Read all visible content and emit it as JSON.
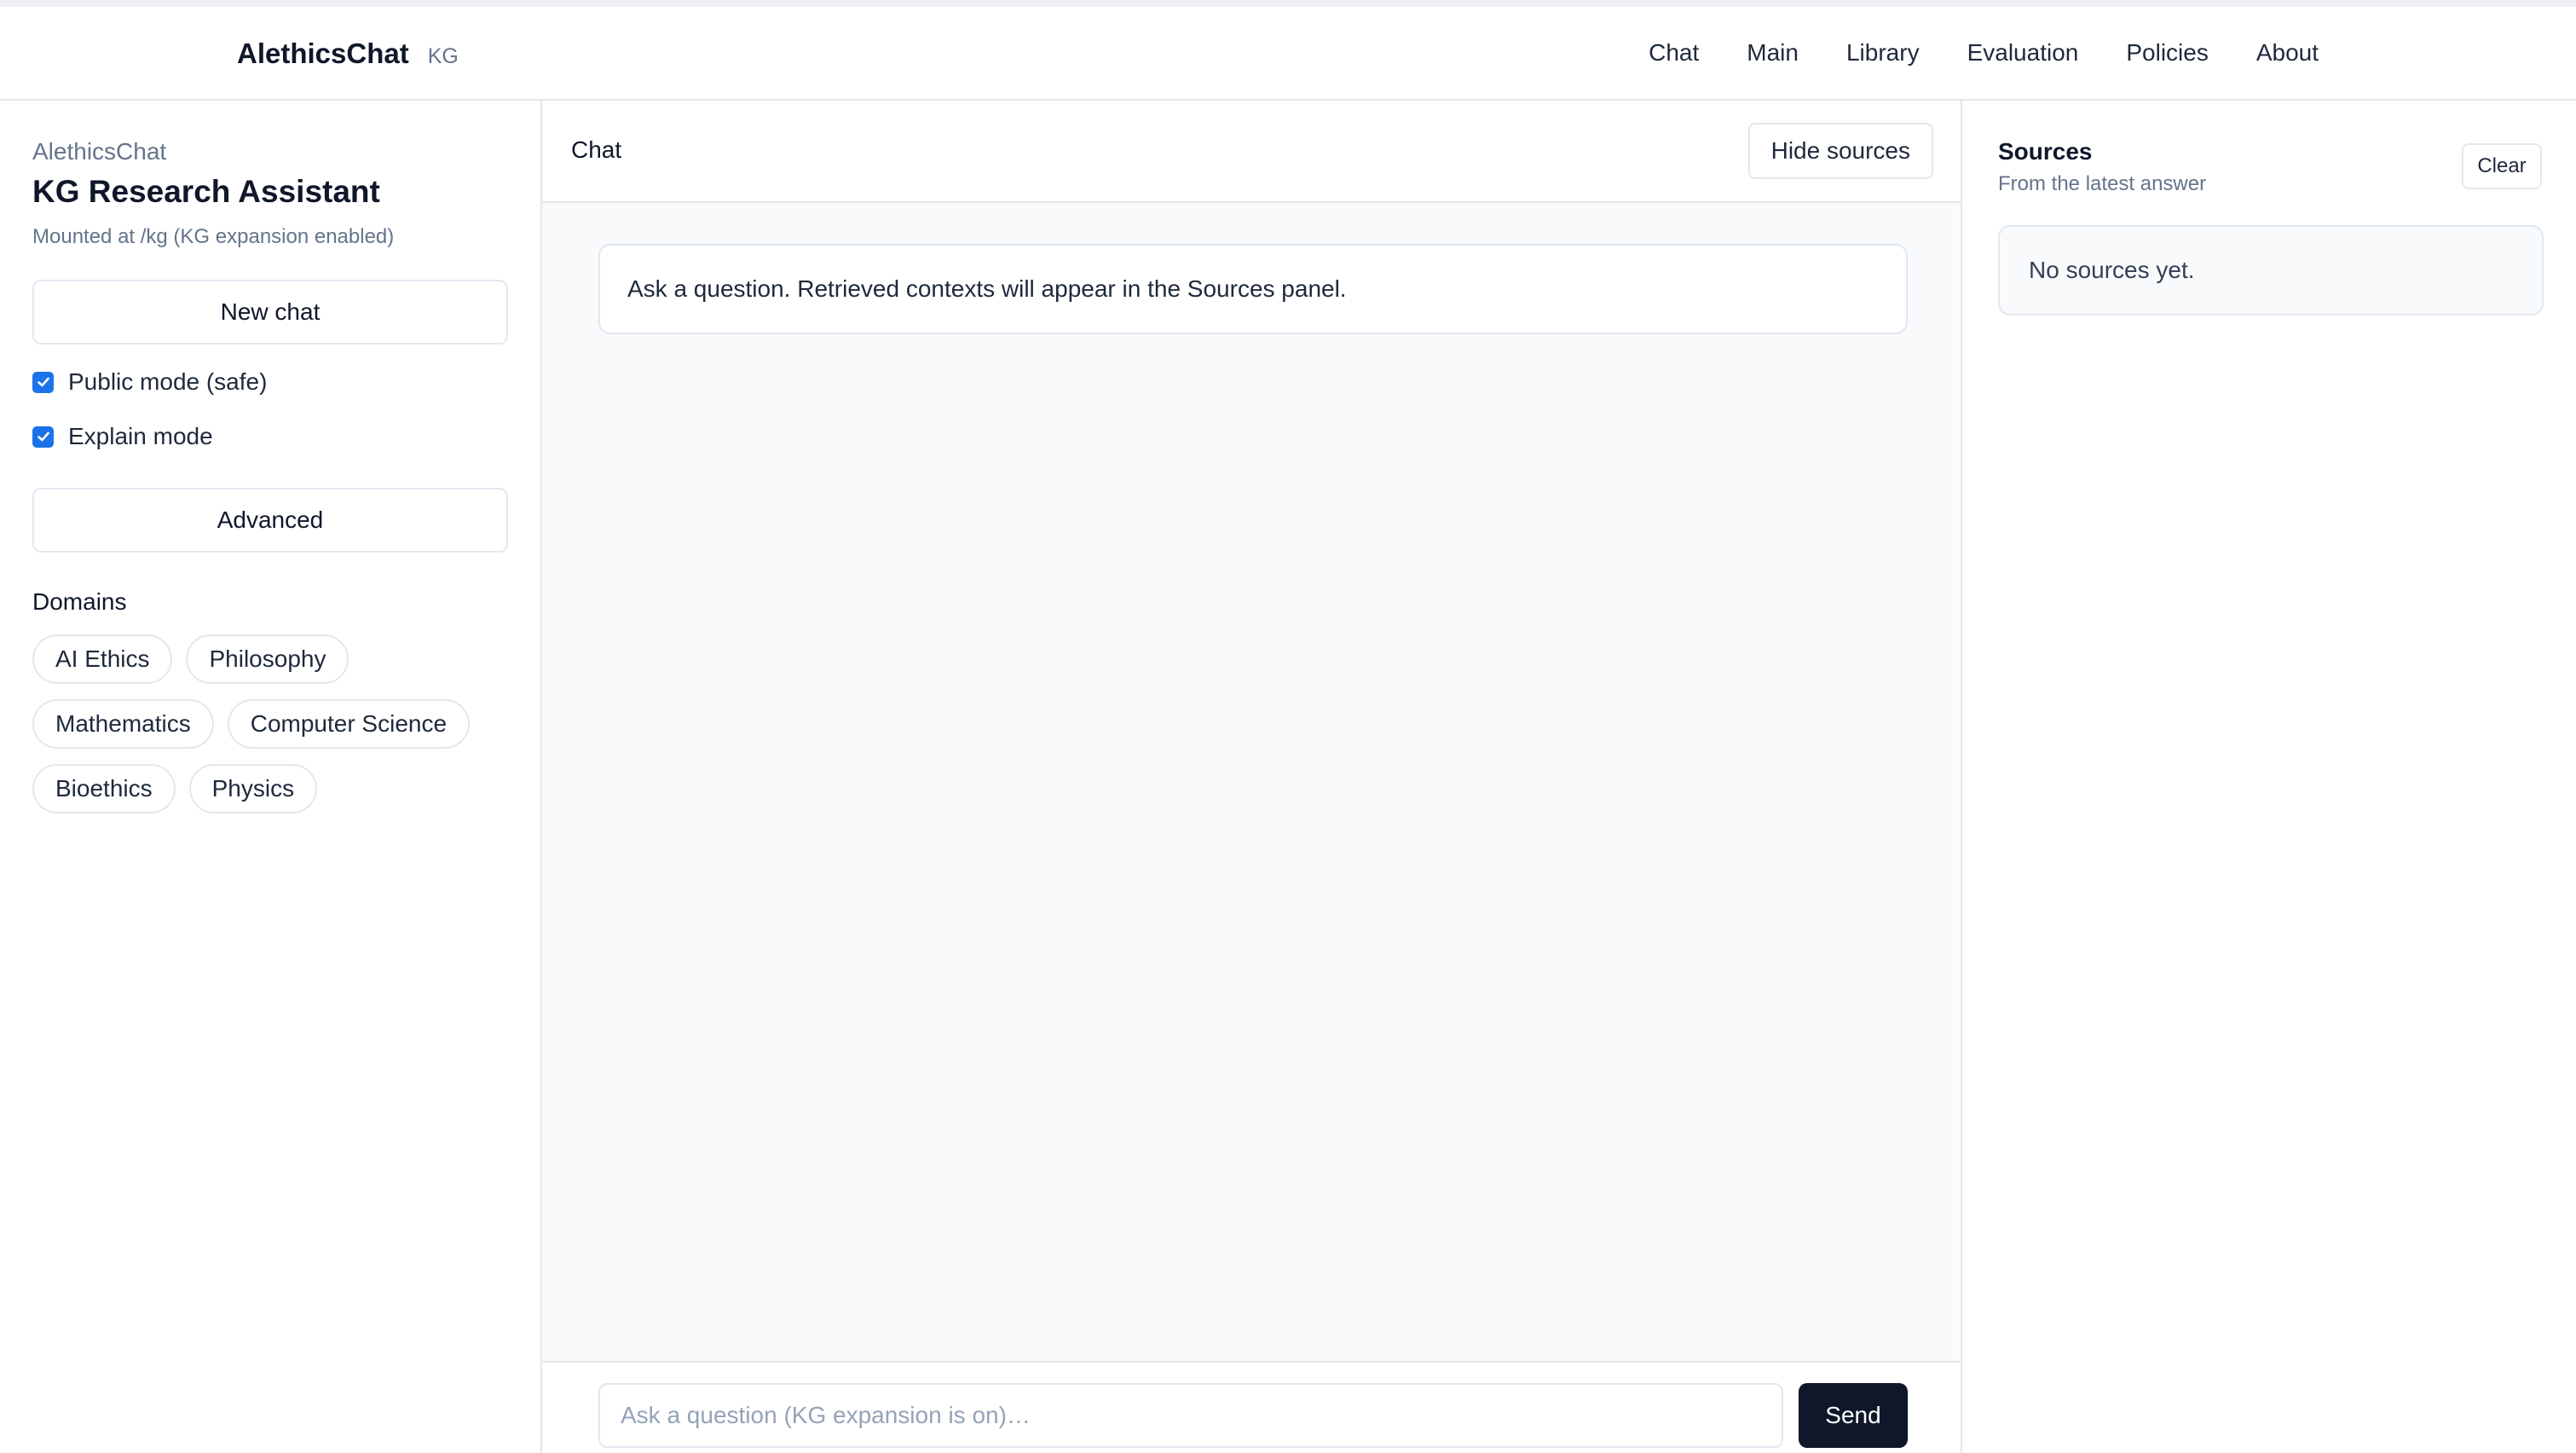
{
  "header": {
    "brand": "AlethicsChat",
    "brand_tag": "KG",
    "nav": [
      {
        "label": "Chat"
      },
      {
        "label": "Main"
      },
      {
        "label": "Library"
      },
      {
        "label": "Evaluation"
      },
      {
        "label": "Policies"
      },
      {
        "label": "About"
      }
    ]
  },
  "sidebar": {
    "app_name": "AlethicsChat",
    "title": "KG Research Assistant",
    "subtitle": "Mounted at /kg (KG expansion enabled)",
    "new_chat_label": "New chat",
    "public_mode": {
      "label": "Public mode (safe)",
      "checked": true
    },
    "explain_mode": {
      "label": "Explain mode",
      "checked": true
    },
    "advanced_label": "Advanced",
    "domains_label": "Domains",
    "domains": [
      {
        "label": "AI Ethics"
      },
      {
        "label": "Philosophy"
      },
      {
        "label": "Mathematics"
      },
      {
        "label": "Computer Science"
      },
      {
        "label": "Bioethics"
      },
      {
        "label": "Physics"
      }
    ]
  },
  "chat": {
    "title": "Chat",
    "hide_sources_label": "Hide sources",
    "intro_message": "Ask a question. Retrieved contexts will appear in the Sources panel.",
    "input_placeholder": "Ask a question (KG expansion is on)…",
    "input_value": "",
    "send_label": "Send"
  },
  "sources": {
    "title": "Sources",
    "subtitle": "From the latest answer",
    "clear_label": "Clear",
    "empty_text": "No sources yet."
  },
  "colors": {
    "accent_dark": "#0f172a",
    "checkbox": "#1a73e8",
    "border": "#e2e8f0",
    "muted_text": "#64748b"
  }
}
